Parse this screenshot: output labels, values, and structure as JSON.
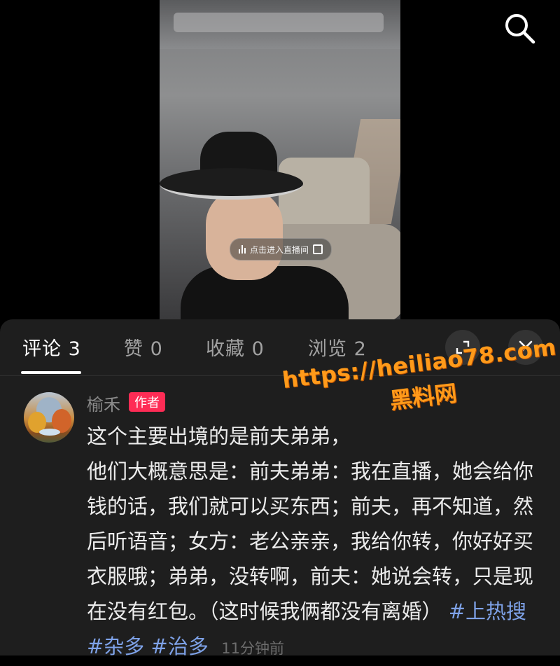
{
  "video": {
    "live_label": "点击进入直播间"
  },
  "tabs": [
    {
      "label": "评论 3",
      "active": true
    },
    {
      "label": "赞 0",
      "active": false
    },
    {
      "label": "收藏 0",
      "active": false
    },
    {
      "label": "浏览 2",
      "active": false
    }
  ],
  "icons": {
    "search": "search-icon",
    "expand": "expand-icon",
    "close": "close-icon"
  },
  "comment": {
    "username": "榆禾",
    "badge": "作者",
    "text": "这个主要出境的是前夫弟弟，\n他们大概意思是：前夫弟弟：我在直播，她会给你钱的话，我们就可以买东西；前夫，再不知道，然后听语音；女方：老公亲亲，我给你转，你好好买衣服哦；弟弟，没转啊，前夫：她说会转，只是现在没有红包。（这时候我俩都没有离婚）",
    "tags": [
      "#上热搜",
      "#杂多",
      "#治多"
    ],
    "time": "11分钟前"
  },
  "watermark": {
    "url": "https://heiliao78.com",
    "name": "黑料网"
  },
  "colors": {
    "badge": "#fe2c55",
    "tag": "#7ea2e8",
    "watermark": "#ff9a1a",
    "sheet": "#1e1e1e"
  }
}
